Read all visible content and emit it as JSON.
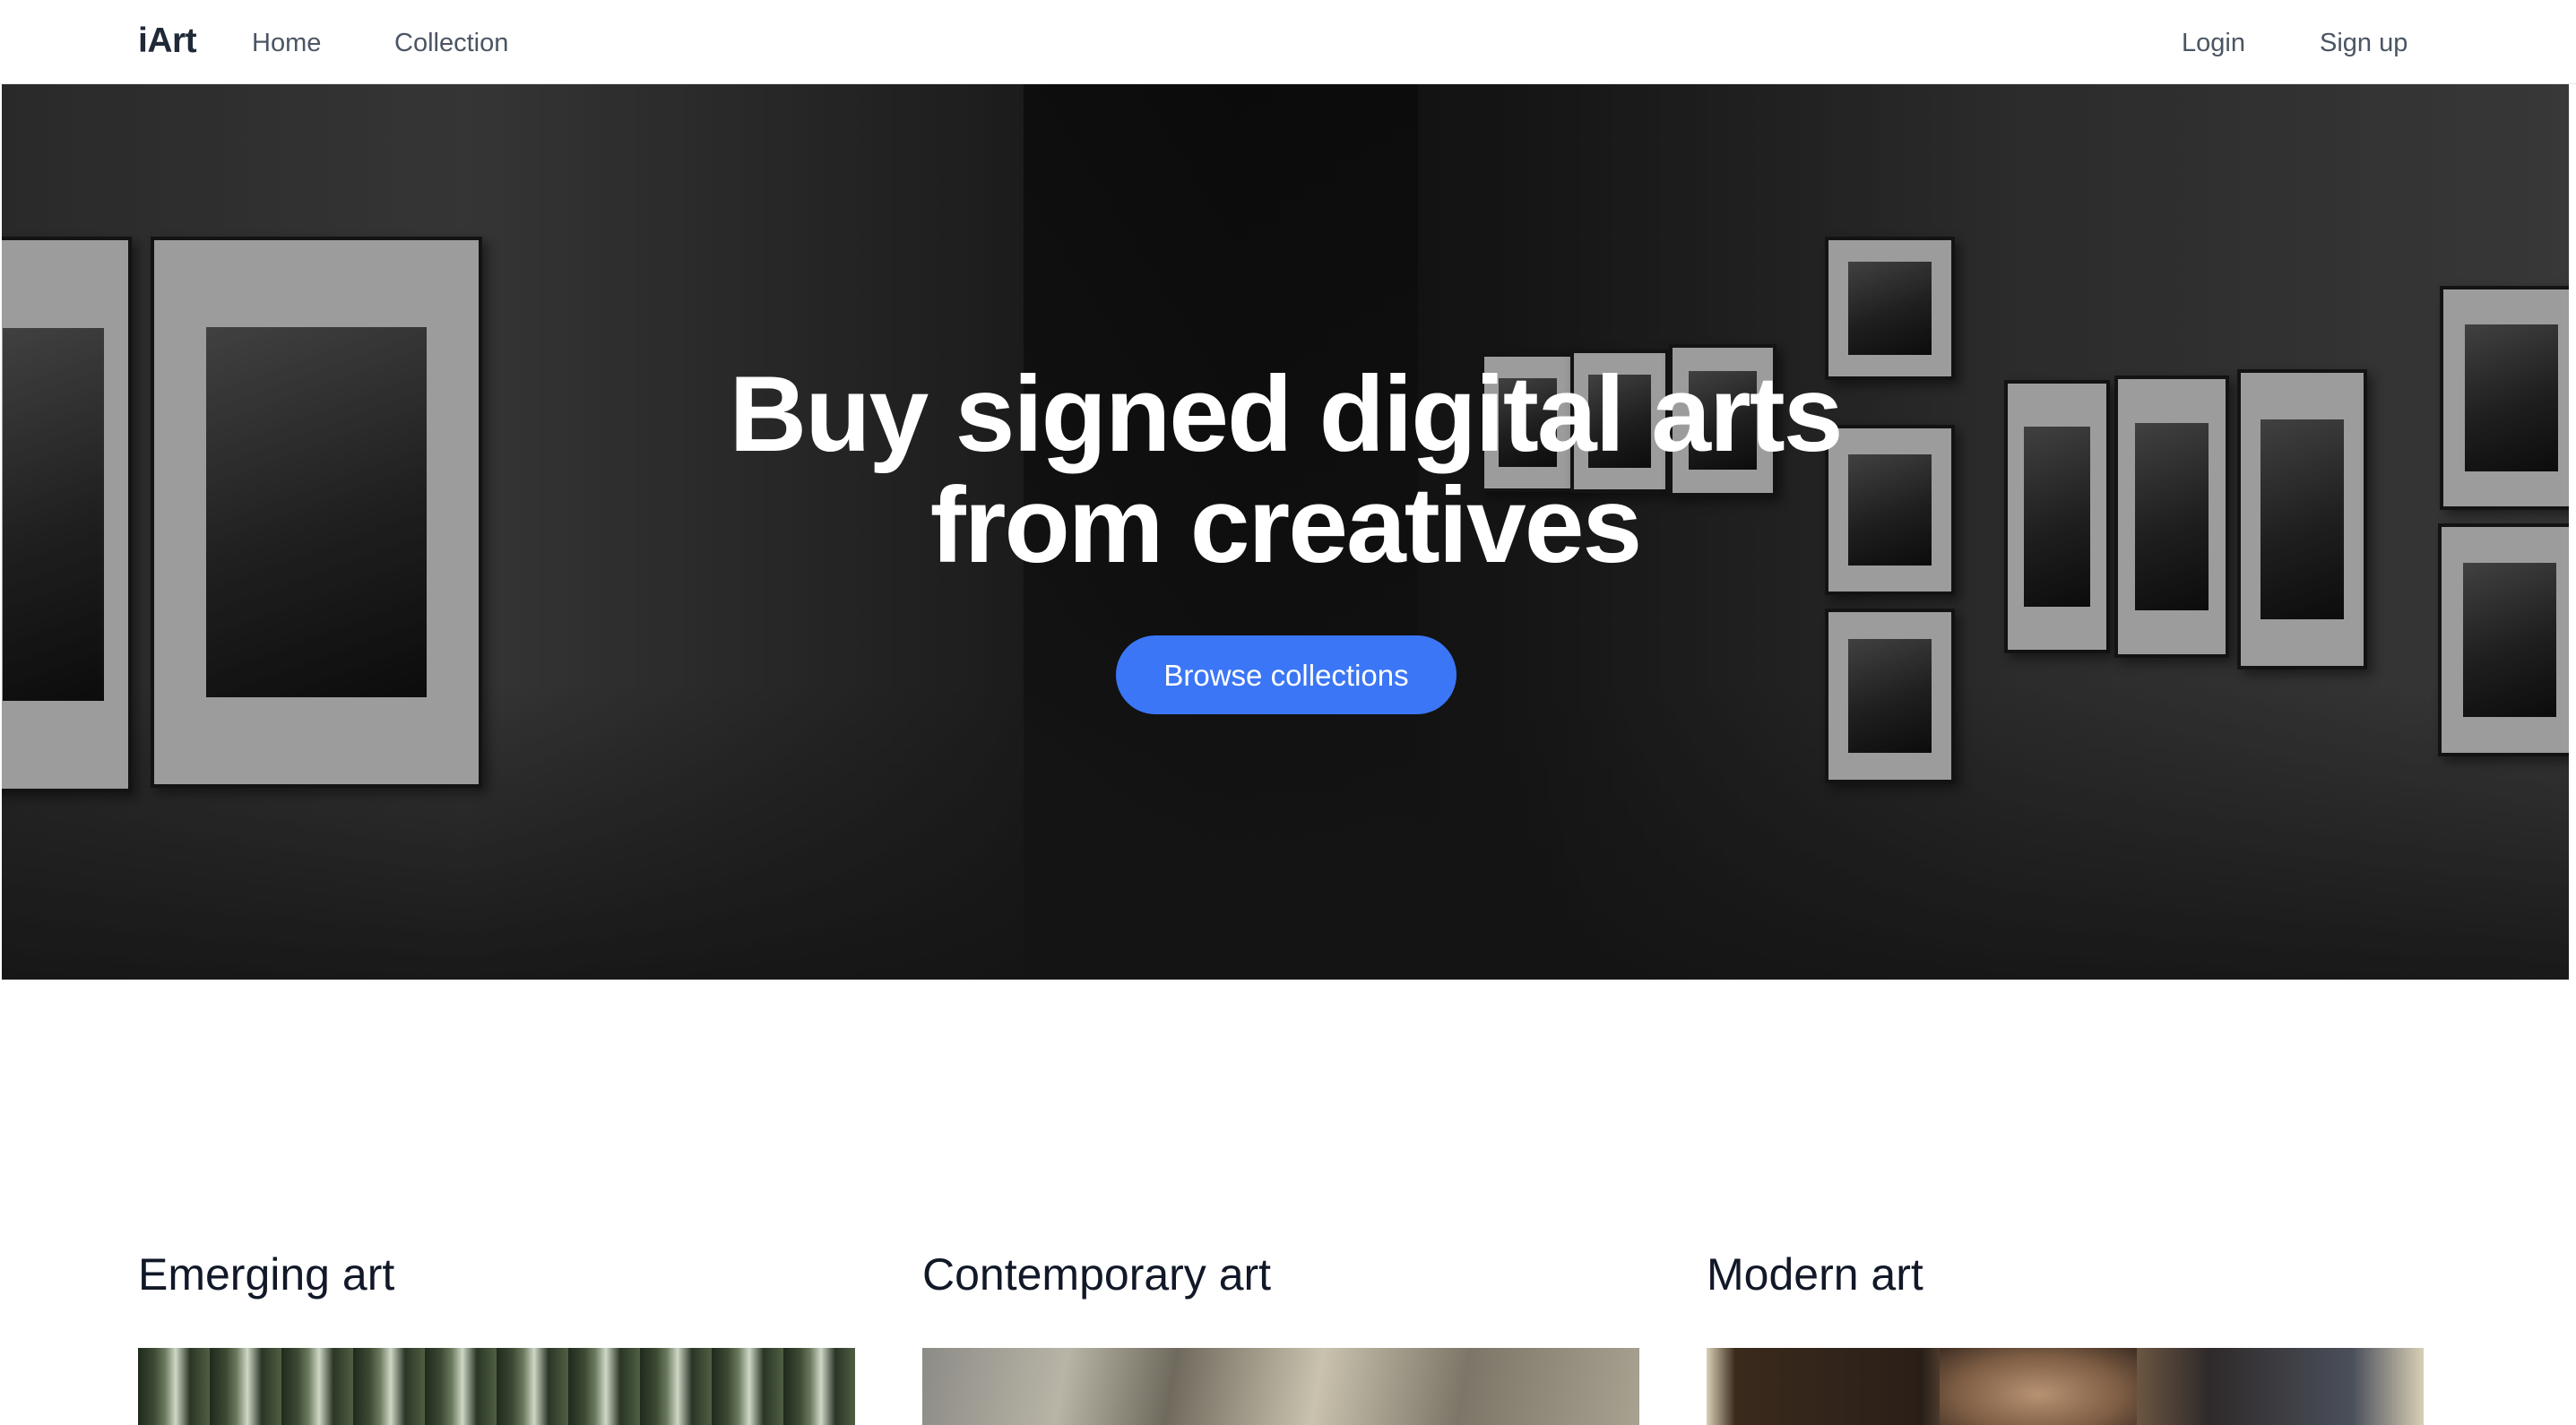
{
  "navbar": {
    "brand": "iArt",
    "links": [
      {
        "label": "Home"
      },
      {
        "label": "Collection"
      }
    ],
    "login_label": "Login",
    "signup_label": "Sign up"
  },
  "hero": {
    "title_line1": "Buy signed digital arts",
    "title_line2": "from creatives",
    "cta_label": "Browse collections",
    "cta_color": "#3b76f6"
  },
  "categories": [
    {
      "title": "Emerging art"
    },
    {
      "title": "Contemporary art"
    },
    {
      "title": "Modern art"
    }
  ]
}
